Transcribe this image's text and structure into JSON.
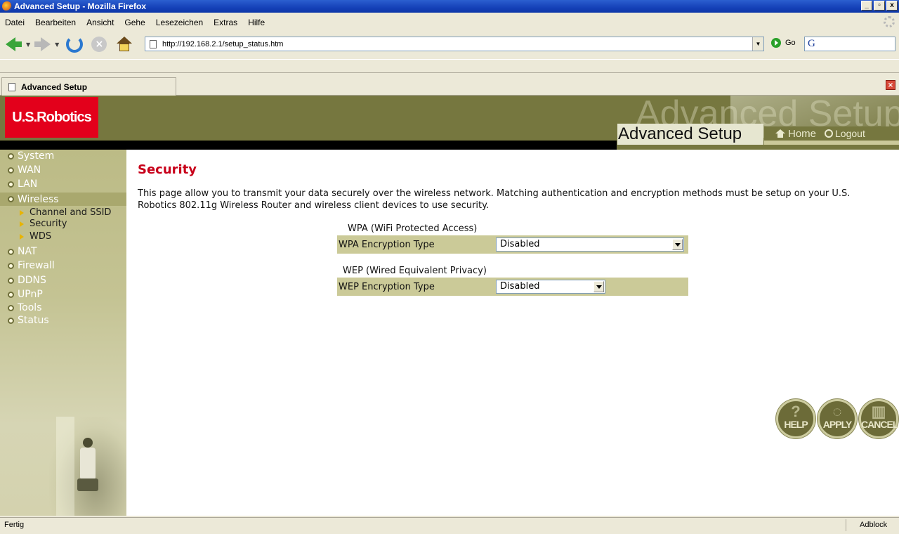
{
  "window": {
    "title": "Advanced Setup - Mozilla Firefox",
    "buttons": [
      "_",
      "▫",
      "x"
    ]
  },
  "menu": [
    "Datei",
    "Bearbeiten",
    "Ansicht",
    "Gehe",
    "Lesezeichen",
    "Extras",
    "Hilfe"
  ],
  "toolbar": {
    "url": "http://192.168.2.1/setup_status.htm",
    "go_label": "Go"
  },
  "tab": {
    "title": "Advanced Setup"
  },
  "header": {
    "logo": "U.S.Robotics",
    "ghost_title": "Advanced Setup",
    "title": "Advanced Setup",
    "home_label": "Home",
    "logout_label": "Logout"
  },
  "sidebar": {
    "items": [
      "System",
      "WAN",
      "LAN",
      "Wireless",
      "NAT",
      "Firewall",
      "DDNS",
      "UPnP",
      "Tools",
      "Status"
    ],
    "active_index": 3,
    "subitems": [
      "Channel and SSID",
      "Security",
      "WDS"
    ]
  },
  "main": {
    "title": "Security",
    "description": "This page allow you to transmit your data securely over the wireless network. Matching authentication and encryption methods must be setup on your U.S. Robotics 802.11g Wireless Router and wireless client devices to use security.",
    "wpa": {
      "section": "WPA (WiFi Protected Access)",
      "label": "WPA Encryption Type",
      "value": "Disabled"
    },
    "wep": {
      "section": "WEP (Wired Equivalent Privacy)",
      "label": "WEP Encryption Type",
      "value": "Disabled"
    },
    "buttons": {
      "help": "HELP",
      "apply": "APPLY",
      "cancel": "CANCEL"
    }
  },
  "statusbar": {
    "status": "Fertig",
    "adblock": "Adblock"
  },
  "colors": {
    "header_olive": "#76773f",
    "title_red": "#c8001a",
    "logo_red": "#e3001b",
    "row_tan": "#cbca98"
  }
}
